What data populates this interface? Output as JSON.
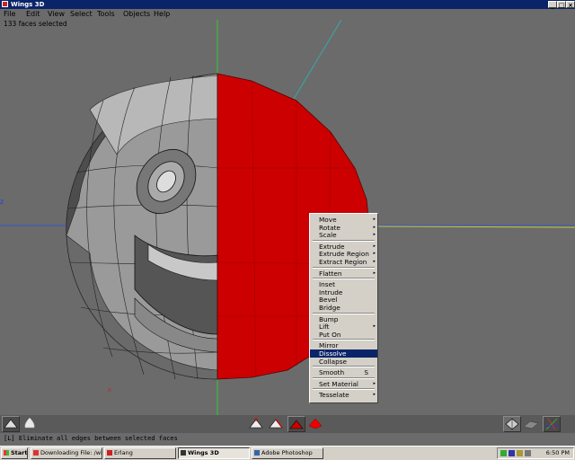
{
  "window": {
    "title": "Wings 3D"
  },
  "menubar": [
    "File",
    "Edit",
    "View",
    "Select",
    "Tools",
    "Objects",
    "Help"
  ],
  "status": "133 faces selected",
  "axis_label": "z",
  "context_menu": {
    "groups": [
      [
        {
          "label": "Move",
          "sub": true
        },
        {
          "label": "Rotate",
          "sub": true
        },
        {
          "label": "Scale",
          "sub": true
        }
      ],
      [
        {
          "label": "Extrude",
          "sub": true
        },
        {
          "label": "Extrude Region",
          "sub": true
        },
        {
          "label": "Extract Region",
          "sub": true
        }
      ],
      [
        {
          "label": "Flatten",
          "sub": true
        }
      ],
      [
        {
          "label": "Inset"
        },
        {
          "label": "Intrude"
        },
        {
          "label": "Bevel"
        },
        {
          "label": "Bridge"
        }
      ],
      [
        {
          "label": "Bump"
        },
        {
          "label": "Lift",
          "sub": true
        },
        {
          "label": "Put On"
        }
      ],
      [
        {
          "label": "Mirror"
        },
        {
          "label": "Dissolve",
          "highlighted": true
        },
        {
          "label": "Collapse"
        }
      ],
      [
        {
          "label": "Smooth",
          "hotkey": "S"
        }
      ],
      [
        {
          "label": "Set Material",
          "sub": true
        }
      ],
      [
        {
          "label": "Tesselate",
          "sub": true
        }
      ]
    ]
  },
  "hint": "[L] Eliminate all edges between selected faces",
  "taskbar": {
    "start": "Start",
    "tasks": [
      {
        "label": "Downloading File: /wings/...",
        "active": false
      },
      {
        "label": "Erlang",
        "active": false
      },
      {
        "label": "Wings 3D",
        "active": true
      },
      {
        "label": "Adobe Photoshop",
        "active": false
      }
    ],
    "clock": "6:50 PM"
  },
  "colors": {
    "selected_face": "#cc0000",
    "mesh_gray": "#9a9a9a",
    "background": "#6b6b6b",
    "highlight": "#0a246a"
  }
}
